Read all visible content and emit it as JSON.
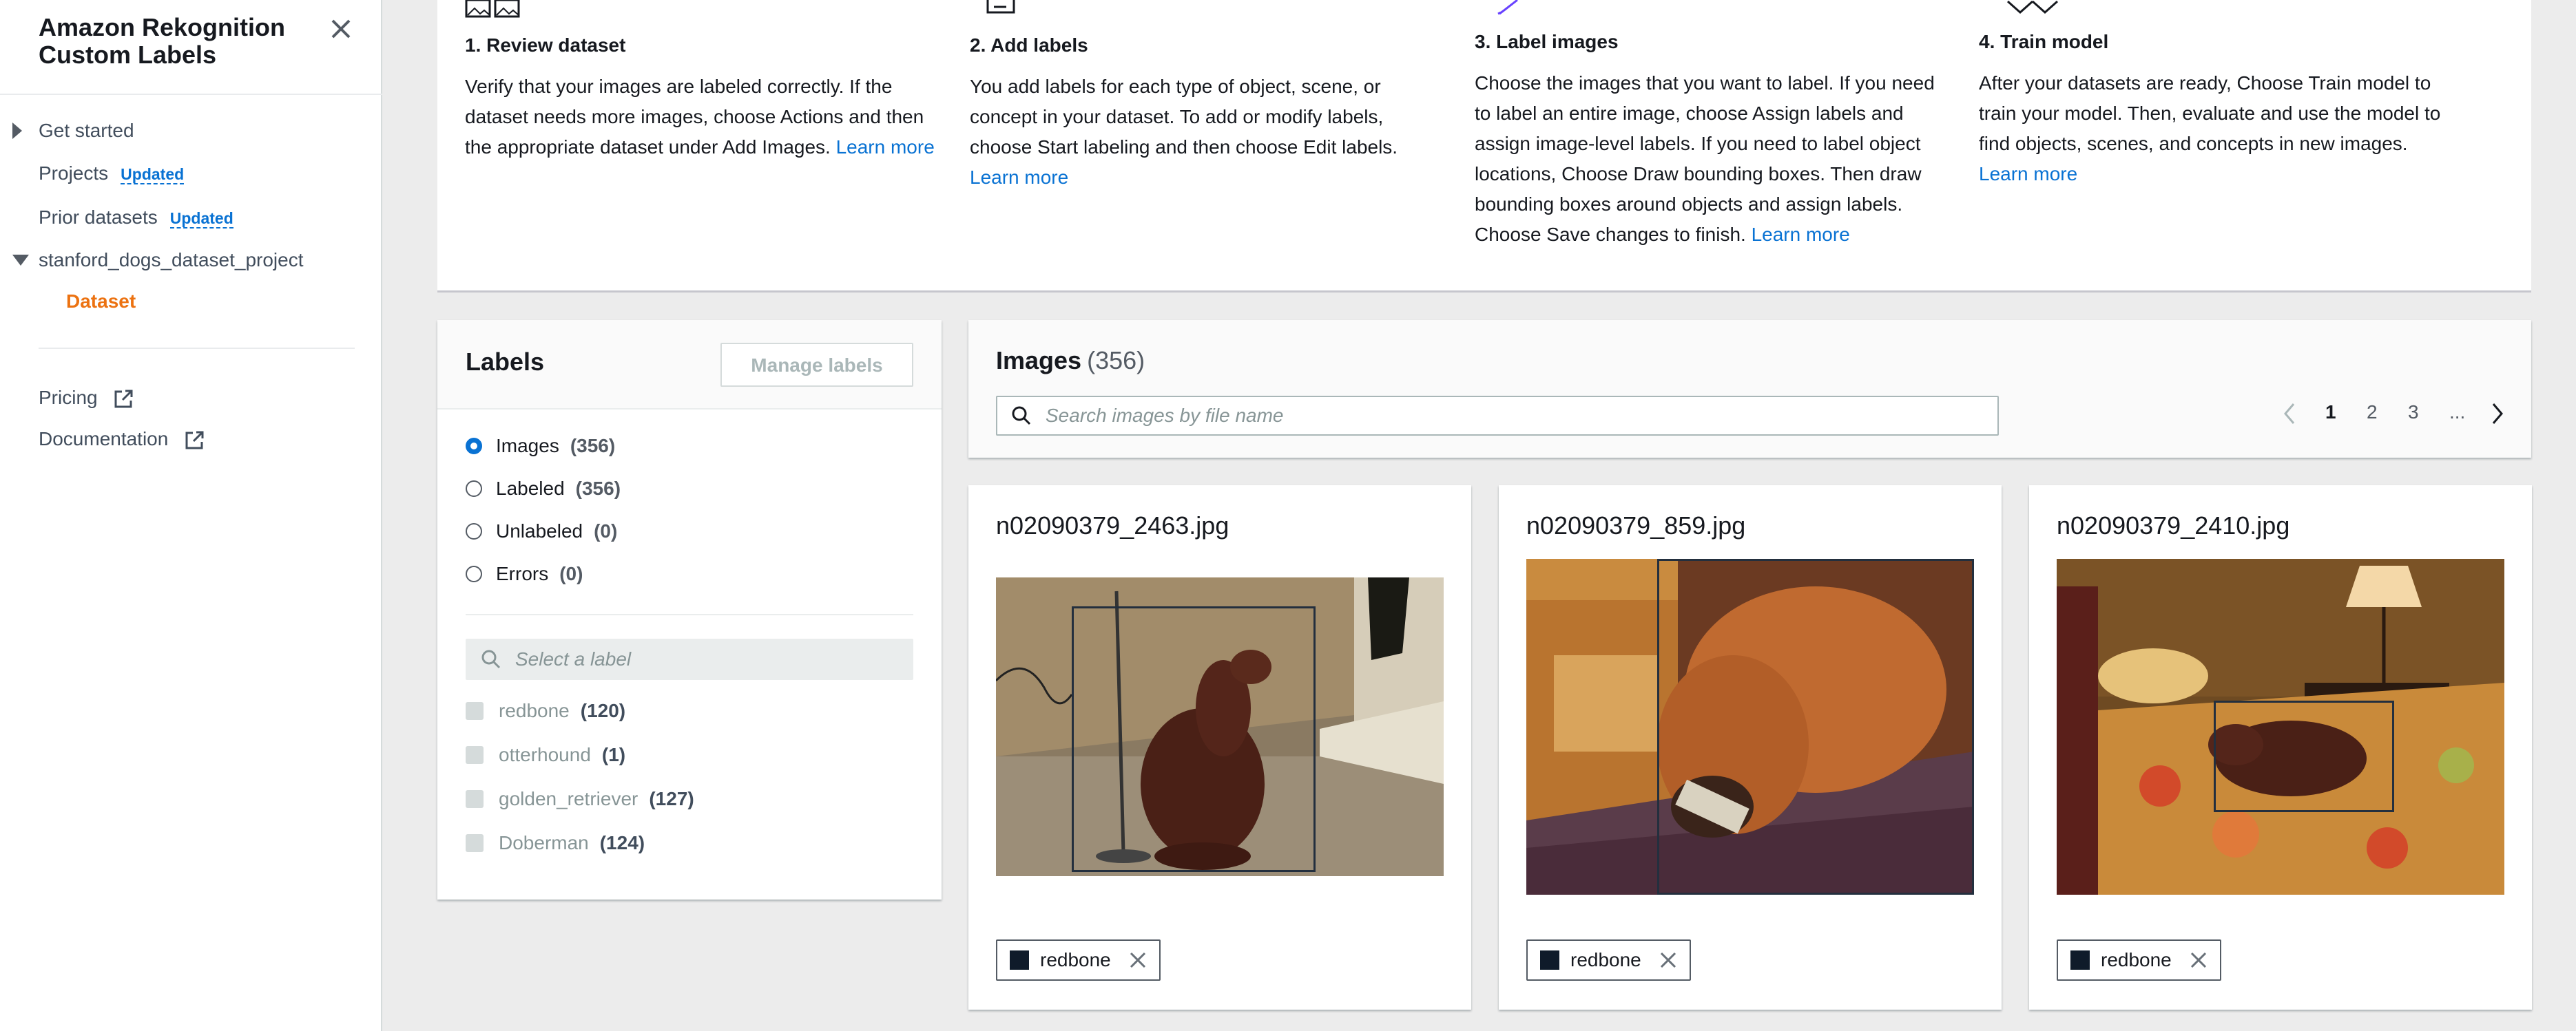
{
  "sidebar": {
    "app_title": "Amazon Rekognition Custom Labels",
    "items": [
      {
        "label": "Get started"
      },
      {
        "label": "Projects",
        "badge": "Updated"
      },
      {
        "label": "Prior datasets",
        "badge": "Updated"
      },
      {
        "label": "stanford_dogs_dataset_project"
      },
      {
        "label": "Dataset"
      },
      {
        "label": "Pricing"
      },
      {
        "label": "Documentation"
      }
    ]
  },
  "steps": [
    {
      "title": "1. Review dataset",
      "desc": "Verify that your images are labeled correctly. If the dataset needs more images, choose Actions and then the appropriate dataset under Add Images.",
      "link": "Learn more"
    },
    {
      "title": "2. Add labels",
      "desc": "You add labels for each type of object, scene, or concept in your dataset. To add or modify labels, choose Start labeling and then choose Edit labels.",
      "link": "Learn more"
    },
    {
      "title": "3. Label images",
      "desc": "Choose the images that you want to label. If you need to label an entire image, choose Assign labels and assign image-level labels. If you need to label object locations, Choose Draw bounding boxes. Then draw bounding boxes around objects and assign labels. Choose Save changes to finish.",
      "link": "Learn more"
    },
    {
      "title": "4. Train model",
      "desc": "After your datasets are ready, Choose Train model to train your model. Then, evaluate and use the model to find objects, scenes, and concepts in new images.",
      "link": "Learn more"
    }
  ],
  "labels_panel": {
    "title": "Labels",
    "manage_button": "Manage labels",
    "filters": [
      {
        "label": "Images",
        "count": "(356)",
        "selected": true
      },
      {
        "label": "Labeled",
        "count": "(356)",
        "selected": false
      },
      {
        "label": "Unlabeled",
        "count": "(0)",
        "selected": false
      },
      {
        "label": "Errors",
        "count": "(0)",
        "selected": false
      }
    ],
    "search_placeholder": "Select a label",
    "labels": [
      {
        "name": "redbone",
        "count": "(120)"
      },
      {
        "name": "otterhound",
        "count": "(1)"
      },
      {
        "name": "golden_retriever",
        "count": "(127)"
      },
      {
        "name": "Doberman",
        "count": "(124)"
      }
    ]
  },
  "images_panel": {
    "title": "Images",
    "count": "(356)",
    "search_placeholder": "Search images by file name",
    "pages": [
      "1",
      "2",
      "3",
      "..."
    ],
    "current_page": "1"
  },
  "cards": [
    {
      "filename": "n02090379_2463.jpg",
      "tag": "redbone"
    },
    {
      "filename": "n02090379_859.jpg",
      "tag": "redbone"
    },
    {
      "filename": "n02090379_2410.jpg",
      "tag": "redbone"
    }
  ],
  "colors": {
    "accent": "#0972d3",
    "active_nav": "#ec7211",
    "label_swatch": "#0f1b2a"
  }
}
